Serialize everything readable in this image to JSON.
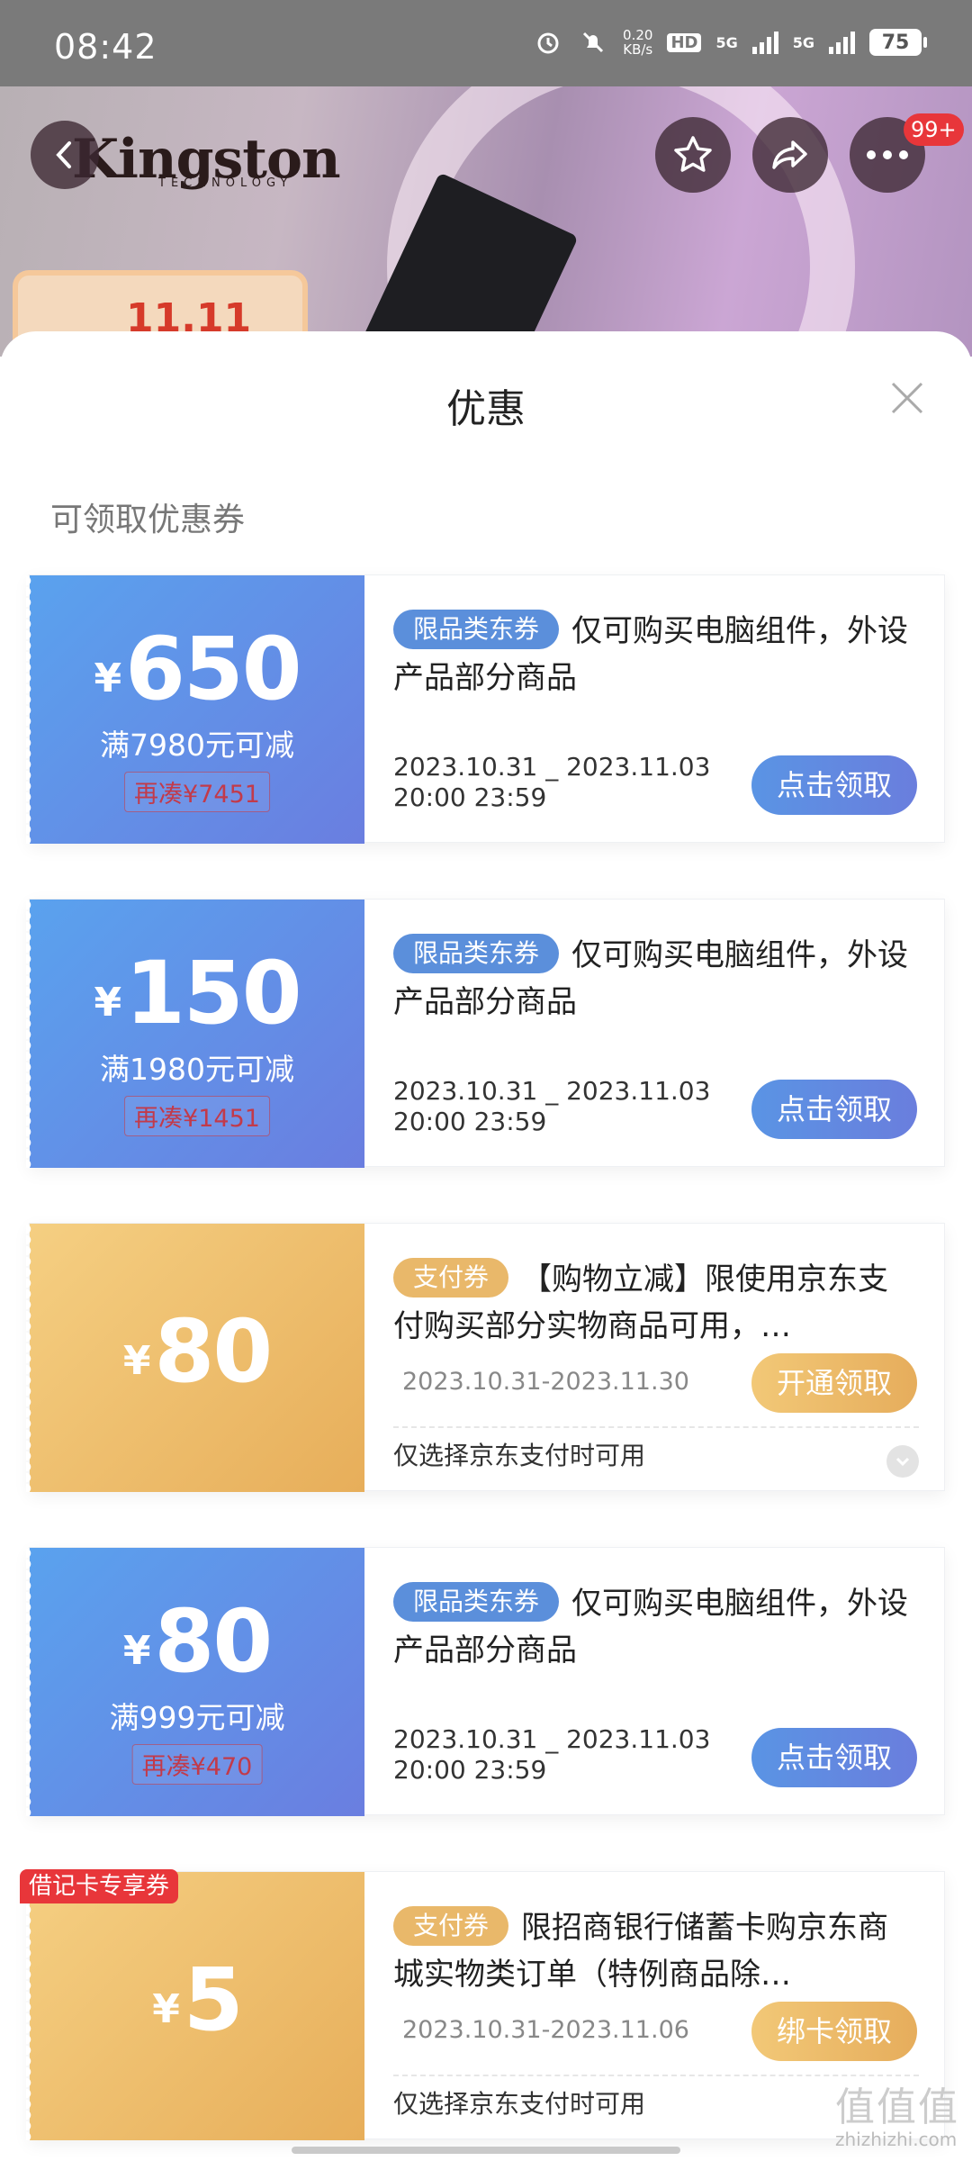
{
  "status_bar": {
    "time": "08:42",
    "net_speed": "0.20\nKB/s",
    "hd": "HD",
    "signal1": "5G",
    "signal2": "5G",
    "battery": "75"
  },
  "header": {
    "brand": "Kingston",
    "brand_sub": "TECHNOLOGY",
    "more_badge": "99+",
    "promo_badge": "11.11"
  },
  "sheet": {
    "title": "优惠",
    "section_label": "可领取优惠券"
  },
  "coupons": [
    {
      "currency": "¥",
      "amount": "650",
      "condition": "满7980元可减",
      "need_more": "再凑¥7451",
      "tag": "限品类东券",
      "description": "仅可购买电脑组件，外设产品部分商品",
      "date_start": "2023.10.31 _ 2023.11.03",
      "date_end": "20:00 23:59",
      "button": "点击领取"
    },
    {
      "currency": "¥",
      "amount": "150",
      "condition": "满1980元可减",
      "need_more": "再凑¥1451",
      "tag": "限品类东券",
      "description": "仅可购买电脑组件，外设产品部分商品",
      "date_start": "2023.10.31 _ 2023.11.03",
      "date_end": "20:00 23:59",
      "button": "点击领取"
    },
    {
      "currency": "¥",
      "amount": "80",
      "tag": "支付券",
      "description": "【购物立减】限使用京东支付购买部分实物商品可用，…",
      "date_range": "2023.10.31-2023.11.30",
      "button": "开通领取",
      "note": "仅选择京东支付时可用"
    },
    {
      "currency": "¥",
      "amount": "80",
      "condition": "满999元可减",
      "need_more": "再凑¥470",
      "tag": "限品类东券",
      "description": "仅可购买电脑组件，外设产品部分商品",
      "date_start": "2023.10.31 _ 2023.11.03",
      "date_end": "20:00 23:59",
      "button": "点击领取"
    },
    {
      "badge": "借记卡专享券",
      "currency": "¥",
      "amount": "5",
      "tag": "支付券",
      "description": "限招商银行储蓄卡购京东商城实物类订单（特例商品除…",
      "date_range": "2023.10.31-2023.11.06",
      "button": "绑卡领取",
      "note": "仅选择京东支付时可用"
    }
  ],
  "watermark": {
    "big": "值值值",
    "url": "zhizhizhi.com"
  },
  "colors": {
    "blue_coupon": "#5aa2ee",
    "gold_coupon": "#e7ae5a",
    "badge_red": "#e8363a"
  }
}
